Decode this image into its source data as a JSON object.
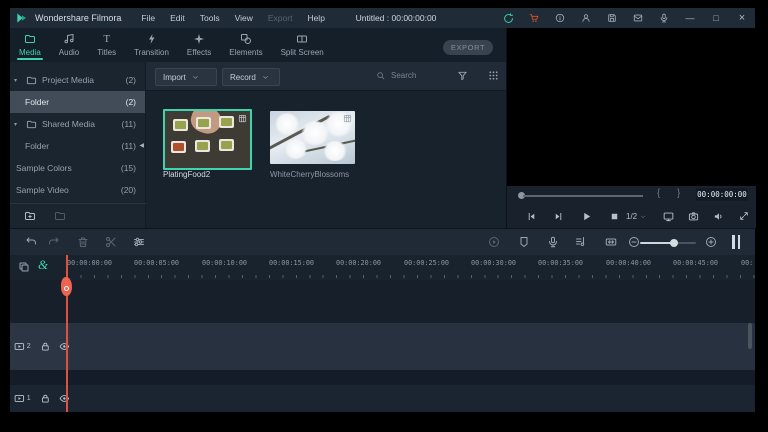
{
  "colors": {
    "accent": "#3fd3ae",
    "cart_orange": "#e2552b",
    "playhead": "#ee6450"
  },
  "titlebar": {
    "brand": "Wondershare Filmora",
    "menus": [
      {
        "label": "File"
      },
      {
        "label": "Edit"
      },
      {
        "label": "Tools"
      },
      {
        "label": "View"
      },
      {
        "label": "Export"
      },
      {
        "label": "Help"
      }
    ],
    "project_title": "Untitled : 00:00:00:00",
    "controls": {
      "minimize": "—",
      "maximize": "□",
      "close": "×"
    }
  },
  "tabbar": {
    "tabs": [
      {
        "label": "Media"
      },
      {
        "label": "Audio"
      },
      {
        "label": "Titles"
      },
      {
        "label": "Transition"
      },
      {
        "label": "Effects"
      },
      {
        "label": "Elements"
      },
      {
        "label": "Split Screen"
      }
    ],
    "titles_glyph": "T",
    "export_label": "EXPORT"
  },
  "sidebar": {
    "rows": [
      {
        "label": "Project Media",
        "count": "(2)"
      },
      {
        "label": "Folder",
        "count": "(2)"
      },
      {
        "label": "Shared Media",
        "count": "(11)"
      },
      {
        "label": "Folder",
        "count": "(11)"
      },
      {
        "label": "Sample Colors",
        "count": "(15)"
      },
      {
        "label": "Sample Video",
        "count": "(20)"
      }
    ],
    "expand_glyph": "▾",
    "collapse_glyph": "◀"
  },
  "media_panel": {
    "import_label": "Import",
    "record_label": "Record",
    "search_placeholder": "Search",
    "items": [
      {
        "name": "PlatingFood2"
      },
      {
        "name": "WhiteCherryBlossoms"
      }
    ]
  },
  "preview": {
    "timecode": "00:00:00:00",
    "speed_label": "1/2",
    "bracket_open": "{",
    "bracket_close": "}"
  },
  "timeline": {
    "magnet_glyph": "&",
    "ruler_labels": [
      "00:00:00:00",
      "00:00:05:00",
      "00:00:10:00",
      "00:00:15:00",
      "00:00:20:00",
      "00:00:25:00",
      "00:00:30:00",
      "00:00:35:00",
      "00:00:40:00",
      "00:00:45:00",
      "00:"
    ],
    "tracks": [
      {
        "number": "2"
      },
      {
        "number": "1"
      }
    ]
  }
}
